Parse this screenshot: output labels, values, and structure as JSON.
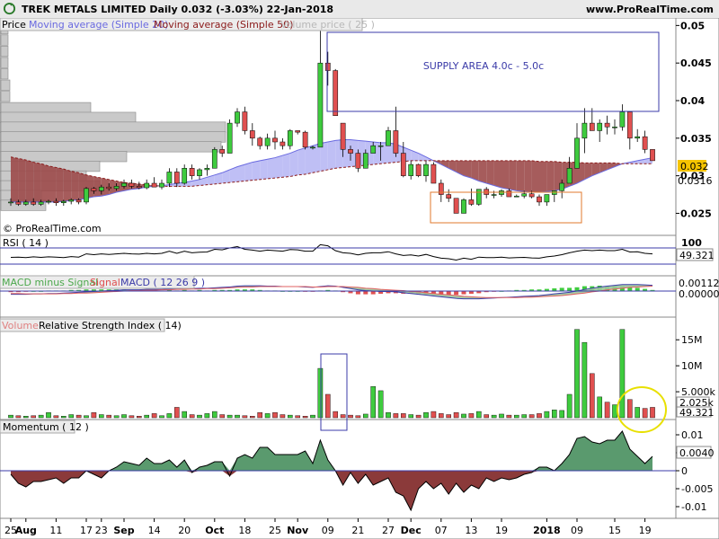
{
  "header": {
    "title": "TREK METALS LIMITED   Daily   0.032 (-3.03%)   22-Jan-2018",
    "site": "www.ProRealTime.com"
  },
  "panels": {
    "price": {
      "legend": [
        "Price",
        "Moving average (Simple 20)",
        "Moving average (Simple 50)",
        "Volume price ( 25 )"
      ],
      "watermark": "© ProRealTime.com",
      "last_label": "0.032",
      "ma_label": "0.0316"
    },
    "rsi": {
      "legend": "RSI ( 14 )",
      "top_label": "100",
      "last_label": "49.321"
    },
    "macd": {
      "legend": [
        "MACD minus Signal",
        "Signal",
        "MACD ( 12 26 9 )"
      ],
      "label1": "0.00112",
      "label2": "0.00000"
    },
    "volume": {
      "legend": [
        "Volume",
        "Relative Strength Index ( 14)"
      ],
      "label1": "2.025k",
      "label2": "49.321"
    },
    "momentum": {
      "legend": "Momentum ( 12 )",
      "last_label": "0.0040"
    }
  },
  "annotations": {
    "supply": "SUPPLY AREA 4.0c - 5.0c"
  },
  "colors": {
    "up": "#3ecb3e",
    "down": "#e05050",
    "ma_fill_bull": "#b8b8f4",
    "ma_fill_bear": "#9c4a4a",
    "supply_box": "#3b3ba8",
    "demand_box": "#e07a2e",
    "highlight_circle": "#e8e000",
    "volume_box": "#3b3ba8"
  },
  "chart_data": {
    "type": "candlestick",
    "x_ticks": [
      {
        "i": 0,
        "label": "25"
      },
      {
        "i": 2,
        "label": "Aug"
      },
      {
        "i": 6,
        "label": "11"
      },
      {
        "i": 10,
        "label": "17"
      },
      {
        "i": 12,
        "label": "23"
      },
      {
        "i": 15,
        "label": "Sep"
      },
      {
        "i": 19,
        "label": "14"
      },
      {
        "i": 23,
        "label": "20"
      },
      {
        "i": 27,
        "label": "Oct"
      },
      {
        "i": 31,
        "label": "18"
      },
      {
        "i": 35,
        "label": "25"
      },
      {
        "i": 38,
        "label": "Nov"
      },
      {
        "i": 42,
        "label": "09"
      },
      {
        "i": 46,
        "label": "21"
      },
      {
        "i": 50,
        "label": "27"
      },
      {
        "i": 53,
        "label": "Dec"
      },
      {
        "i": 57,
        "label": "07"
      },
      {
        "i": 61,
        "label": "13"
      },
      {
        "i": 65,
        "label": "19"
      },
      {
        "i": 71,
        "label": "2018"
      },
      {
        "i": 75,
        "label": "09"
      },
      {
        "i": 80,
        "label": "15"
      },
      {
        "i": 84,
        "label": "19"
      }
    ],
    "price_axis": {
      "ticks": [
        0.025,
        0.03,
        0.035,
        0.04,
        0.045,
        0.05
      ],
      "range": [
        0.0235,
        0.051
      ]
    },
    "candles": [
      [
        0.0265,
        0.027,
        0.026,
        0.0265
      ],
      [
        0.0265,
        0.0268,
        0.026,
        0.0262
      ],
      [
        0.0262,
        0.0268,
        0.026,
        0.0265
      ],
      [
        0.0265,
        0.027,
        0.026,
        0.0262
      ],
      [
        0.0262,
        0.0268,
        0.026,
        0.0265
      ],
      [
        0.0265,
        0.0268,
        0.0262,
        0.0266
      ],
      [
        0.0266,
        0.027,
        0.026,
        0.0264
      ],
      [
        0.0264,
        0.0268,
        0.026,
        0.0266
      ],
      [
        0.0266,
        0.027,
        0.0262,
        0.0268
      ],
      [
        0.0268,
        0.027,
        0.0262,
        0.0265
      ],
      [
        0.0265,
        0.0285,
        0.0262,
        0.0283
      ],
      [
        0.0283,
        0.0285,
        0.0276,
        0.028
      ],
      [
        0.028,
        0.0288,
        0.0275,
        0.0285
      ],
      [
        0.0285,
        0.029,
        0.028,
        0.0283
      ],
      [
        0.0283,
        0.029,
        0.028,
        0.0286
      ],
      [
        0.0286,
        0.0295,
        0.0283,
        0.029
      ],
      [
        0.029,
        0.0295,
        0.0283,
        0.0286
      ],
      [
        0.0286,
        0.0292,
        0.0282,
        0.0284
      ],
      [
        0.0284,
        0.0295,
        0.0282,
        0.029
      ],
      [
        0.029,
        0.0298,
        0.0285,
        0.0285
      ],
      [
        0.0285,
        0.0295,
        0.0282,
        0.029
      ],
      [
        0.029,
        0.031,
        0.0285,
        0.0305
      ],
      [
        0.0305,
        0.031,
        0.0285,
        0.029
      ],
      [
        0.029,
        0.0315,
        0.0288,
        0.031
      ],
      [
        0.031,
        0.0315,
        0.0295,
        0.03
      ],
      [
        0.03,
        0.031,
        0.0295,
        0.0308
      ],
      [
        0.0308,
        0.0315,
        0.03,
        0.031
      ],
      [
        0.031,
        0.0338,
        0.031,
        0.0335
      ],
      [
        0.0335,
        0.034,
        0.0325,
        0.033
      ],
      [
        0.033,
        0.0375,
        0.033,
        0.037
      ],
      [
        0.037,
        0.039,
        0.0365,
        0.0385
      ],
      [
        0.0385,
        0.0392,
        0.0355,
        0.036
      ],
      [
        0.036,
        0.037,
        0.034,
        0.035
      ],
      [
        0.035,
        0.0352,
        0.0335,
        0.034
      ],
      [
        0.034,
        0.0356,
        0.0335,
        0.035
      ],
      [
        0.035,
        0.036,
        0.0335,
        0.0345
      ],
      [
        0.0345,
        0.035,
        0.0335,
        0.034
      ],
      [
        0.034,
        0.0362,
        0.0335,
        0.036
      ],
      [
        0.036,
        0.036,
        0.0355,
        0.0358
      ],
      [
        0.0358,
        0.036,
        0.0335,
        0.0338
      ],
      [
        0.0338,
        0.034,
        0.0335,
        0.0338
      ],
      [
        0.0338,
        0.05,
        0.0338,
        0.045
      ],
      [
        0.045,
        0.0465,
        0.042,
        0.044
      ],
      [
        0.044,
        0.0442,
        0.038,
        0.038
      ],
      [
        0.037,
        0.037,
        0.0325,
        0.0335
      ],
      [
        0.0335,
        0.034,
        0.032,
        0.033
      ],
      [
        0.033,
        0.0335,
        0.0305,
        0.031
      ],
      [
        0.031,
        0.0335,
        0.031,
        0.033
      ],
      [
        0.033,
        0.0345,
        0.033,
        0.034
      ],
      [
        0.034,
        0.0345,
        0.032,
        0.034
      ],
      [
        0.034,
        0.0365,
        0.034,
        0.036
      ],
      [
        0.036,
        0.0392,
        0.0325,
        0.033
      ],
      [
        0.033,
        0.0345,
        0.0298,
        0.03
      ],
      [
        0.03,
        0.032,
        0.0295,
        0.0315
      ],
      [
        0.0315,
        0.0316,
        0.0298,
        0.03
      ],
      [
        0.03,
        0.032,
        0.0292,
        0.0315
      ],
      [
        0.0315,
        0.0318,
        0.029,
        0.029
      ],
      [
        0.029,
        0.0295,
        0.0265,
        0.0275
      ],
      [
        0.0275,
        0.0282,
        0.0265,
        0.027
      ],
      [
        0.027,
        0.027,
        0.025,
        0.025
      ],
      [
        0.025,
        0.027,
        0.025,
        0.0268
      ],
      [
        0.0268,
        0.0283,
        0.026,
        0.0262
      ],
      [
        0.0262,
        0.0282,
        0.026,
        0.0282
      ],
      [
        0.0282,
        0.0285,
        0.027,
        0.0275
      ],
      [
        0.0275,
        0.028,
        0.027,
        0.0275
      ],
      [
        0.0275,
        0.0282,
        0.0272,
        0.028
      ],
      [
        0.028,
        0.0283,
        0.0272,
        0.0272
      ],
      [
        0.0272,
        0.0275,
        0.0272,
        0.0273
      ],
      [
        0.0273,
        0.028,
        0.027,
        0.0276
      ],
      [
        0.0276,
        0.028,
        0.027,
        0.0272
      ],
      [
        0.0272,
        0.0275,
        0.026,
        0.0265
      ],
      [
        0.0265,
        0.0275,
        0.026,
        0.0275
      ],
      [
        0.0275,
        0.028,
        0.0265,
        0.028
      ],
      [
        0.028,
        0.0295,
        0.027,
        0.029
      ],
      [
        0.029,
        0.0325,
        0.029,
        0.031
      ],
      [
        0.031,
        0.037,
        0.031,
        0.035
      ],
      [
        0.035,
        0.039,
        0.033,
        0.037
      ],
      [
        0.037,
        0.039,
        0.036,
        0.036
      ],
      [
        0.036,
        0.0375,
        0.0345,
        0.037
      ],
      [
        0.037,
        0.038,
        0.0355,
        0.0365
      ],
      [
        0.0365,
        0.0375,
        0.0355,
        0.0365
      ],
      [
        0.0365,
        0.0395,
        0.036,
        0.0385
      ],
      [
        0.0385,
        0.0385,
        0.0335,
        0.035
      ],
      [
        0.035,
        0.0362,
        0.0345,
        0.0352
      ],
      [
        0.0352,
        0.036,
        0.033,
        0.0335
      ],
      [
        0.0335,
        0.0335,
        0.032,
        0.032
      ]
    ],
    "ma20": [
      0.0265,
      0.0265,
      0.0265,
      0.0265,
      0.0265,
      0.0265,
      0.0265,
      0.0266,
      0.0267,
      0.0268,
      0.027,
      0.0272,
      0.0273,
      0.0275,
      0.0278,
      0.028,
      0.0282,
      0.0283,
      0.0285,
      0.0286,
      0.0287,
      0.0288,
      0.029,
      0.0291,
      0.0293,
      0.0295,
      0.0298,
      0.0301,
      0.0304,
      0.0308,
      0.0312,
      0.0315,
      0.0318,
      0.032,
      0.0322,
      0.0324,
      0.0327,
      0.033,
      0.0334,
      0.0337,
      0.034,
      0.0343,
      0.0345,
      0.0347,
      0.0348,
      0.0348,
      0.0347,
      0.0346,
      0.0345,
      0.0344,
      0.0344,
      0.0342,
      0.0338,
      0.0334,
      0.033,
      0.0325,
      0.032,
      0.0315,
      0.031,
      0.0305,
      0.03,
      0.0297,
      0.0293,
      0.029,
      0.0287,
      0.0284,
      0.0282,
      0.028,
      0.0279,
      0.0278,
      0.0278,
      0.0279,
      0.028,
      0.0282,
      0.0286,
      0.029,
      0.0295,
      0.03,
      0.0304,
      0.0308,
      0.0312,
      0.0316,
      0.0318,
      0.032,
      0.0322,
      0.0324
    ],
    "ma50": [
      0.0325,
      0.0323,
      0.0321,
      0.0318,
      0.0316,
      0.0313,
      0.0311,
      0.0309,
      0.0306,
      0.0304,
      0.0301,
      0.0299,
      0.0297,
      0.0295,
      0.0293,
      0.0291,
      0.029,
      0.0289,
      0.0288,
      0.0287,
      0.0286,
      0.0286,
      0.0286,
      0.0286,
      0.0286,
      0.0287,
      0.0288,
      0.0289,
      0.029,
      0.0291,
      0.0292,
      0.0293,
      0.0294,
      0.0295,
      0.0296,
      0.0297,
      0.0298,
      0.0299,
      0.0301,
      0.0302,
      0.0304,
      0.0306,
      0.0308,
      0.031,
      0.0311,
      0.0312,
      0.0313,
      0.0314,
      0.0315,
      0.0316,
      0.0317,
      0.0318,
      0.0319,
      0.032,
      0.032,
      0.032,
      0.032,
      0.032,
      0.032,
      0.032,
      0.032,
      0.032,
      0.032,
      0.032,
      0.032,
      0.032,
      0.032,
      0.032,
      0.032,
      0.032,
      0.0319,
      0.0319,
      0.0319,
      0.0318,
      0.0318,
      0.0318,
      0.0317,
      0.0317,
      0.0317,
      0.0317,
      0.0317,
      0.0316,
      0.0316,
      0.0316,
      0.0316,
      0.0316
    ],
    "vp_bins": [
      {
        "price": 0.0495,
        "w": 8
      },
      {
        "price": 0.048,
        "w": 8
      },
      {
        "price": 0.0465,
        "w": 8
      },
      {
        "price": 0.045,
        "w": 8
      },
      {
        "price": 0.0435,
        "w": 8
      },
      {
        "price": 0.042,
        "w": 10
      },
      {
        "price": 0.0405,
        "w": 10
      },
      {
        "price": 0.039,
        "w": 100
      },
      {
        "price": 0.0377,
        "w": 150
      },
      {
        "price": 0.0364,
        "w": 250
      },
      {
        "price": 0.0351,
        "w": 250
      },
      {
        "price": 0.0338,
        "w": 245
      },
      {
        "price": 0.0325,
        "w": 140
      },
      {
        "price": 0.0312,
        "w": 110
      },
      {
        "price": 0.0299,
        "w": 95
      },
      {
        "price": 0.0286,
        "w": 110
      },
      {
        "price": 0.0273,
        "w": 45
      },
      {
        "price": 0.026,
        "w": 50
      }
    ],
    "volume": {
      "axis_ticks": [
        "5.000k",
        "10M",
        "15M"
      ],
      "tick_values": [
        5,
        10,
        15
      ],
      "range": [
        0,
        18.5
      ],
      "values": [
        0.5,
        0.4,
        0.3,
        0.4,
        0.5,
        1,
        0.4,
        0.3,
        0.6,
        0.5,
        0.4,
        1,
        0.6,
        0.5,
        0.4,
        0.6,
        0.4,
        0.3,
        0.5,
        0.8,
        0.4,
        0.8,
        2,
        1.2,
        0.6,
        0.5,
        0.8,
        1.2,
        0.6,
        0.5,
        0.5,
        0.4,
        0.3,
        1,
        0.8,
        1,
        0.6,
        0.5,
        0.4,
        0.3,
        0.5,
        9.5,
        4.5,
        1.2,
        0.6,
        0.5,
        0.4,
        0.7,
        6,
        5.2,
        1,
        0.8,
        0.8,
        0.6,
        0.5,
        1,
        1.2,
        0.8,
        0.6,
        1,
        0.7,
        0.8,
        1.2,
        0.6,
        0.5,
        0.7,
        0.5,
        0.5,
        0.6,
        0.6,
        0.8,
        1.2,
        1.5,
        1.4,
        4.5,
        17,
        14.5,
        8.5,
        4,
        3,
        2.5,
        17,
        3.5,
        2,
        1.8,
        2
      ]
    },
    "rsi": {
      "range": [
        0,
        100
      ],
      "values": [
        45,
        46,
        44,
        47,
        45,
        47,
        46,
        44,
        48,
        46,
        58,
        55,
        58,
        56,
        58,
        60,
        58,
        57,
        60,
        58,
        60,
        68,
        60,
        68,
        62,
        64,
        65,
        75,
        73,
        80,
        85,
        75,
        72,
        68,
        72,
        70,
        68,
        74,
        73,
        68,
        68,
        92,
        88,
        70,
        62,
        60,
        54,
        60,
        62,
        62,
        66,
        58,
        52,
        54,
        50,
        56,
        48,
        42,
        40,
        35,
        42,
        38,
        46,
        44,
        44,
        46,
        43,
        44,
        45,
        43,
        42,
        47,
        50,
        55,
        62,
        68,
        72,
        70,
        72,
        70,
        70,
        75,
        65,
        66,
        60,
        58
      ]
    },
    "macd": {
      "range": [
        -0.003,
        0.0025
      ],
      "macd": [
        -0.0005,
        -0.0005,
        -0.0005,
        -0.0004,
        -0.0004,
        -0.0003,
        -0.0003,
        -0.0002,
        -0.0001,
        0,
        0.0001,
        0.0002,
        0.0003,
        0.0004,
        0.0005,
        0.0006,
        0.0006,
        0.0006,
        0.0007,
        0.0007,
        0.0007,
        0.0008,
        0.0008,
        0.0009,
        0.0009,
        0.001,
        0.001,
        0.0011,
        0.0012,
        0.0013,
        0.0015,
        0.0016,
        0.0016,
        0.0016,
        0.0015,
        0.0015,
        0.0014,
        0.0014,
        0.0014,
        0.0013,
        0.0012,
        0.0014,
        0.0016,
        0.0015,
        0.0012,
        0.0009,
        0.0006,
        0.0004,
        0.0003,
        0.0002,
        0.0002,
        0.0001,
        -0.0001,
        -0.0003,
        -0.0005,
        -0.0007,
        -0.0009,
        -0.0011,
        -0.0013,
        -0.0015,
        -0.0016,
        -0.0016,
        -0.0016,
        -0.0015,
        -0.0014,
        -0.0013,
        -0.0012,
        -0.0011,
        -0.001,
        -0.0009,
        -0.0008,
        -0.0006,
        -0.0004,
        -0.0002,
        0,
        0.0003,
        0.0007,
        0.001,
        0.0013,
        0.0015,
        0.0017,
        0.0019,
        0.0019,
        0.0019,
        0.0018,
        0.0017
      ],
      "signal": [
        -0.0003,
        -0.0003,
        -0.0004,
        -0.0004,
        -0.0004,
        -0.0004,
        -0.0004,
        -0.0003,
        -0.0003,
        -0.0002,
        -0.0002,
        -0.0001,
        0,
        0.0001,
        0.0002,
        0.0003,
        0.0004,
        0.0004,
        0.0005,
        0.0005,
        0.0006,
        0.0006,
        0.0007,
        0.0007,
        0.0008,
        0.0008,
        0.0009,
        0.0009,
        0.001,
        0.0011,
        0.0012,
        0.0013,
        0.0013,
        0.0014,
        0.0014,
        0.0014,
        0.0014,
        0.0014,
        0.0014,
        0.0014,
        0.0013,
        0.0013,
        0.0014,
        0.0014,
        0.0014,
        0.0013,
        0.0012,
        0.001,
        0.0009,
        0.0007,
        0.0006,
        0.0005,
        0.0004,
        0.0002,
        0.0001,
        -0.0001,
        -0.0003,
        -0.0005,
        -0.0006,
        -0.0008,
        -0.001,
        -0.0011,
        -0.0012,
        -0.0013,
        -0.0013,
        -0.0013,
        -0.0013,
        -0.0013,
        -0.0012,
        -0.0012,
        -0.0011,
        -0.001,
        -0.0009,
        -0.0008,
        -0.0006,
        -0.0004,
        -0.0002,
        0.0001,
        0.0003,
        0.0006,
        0.0008,
        0.001,
        0.0012,
        0.0013,
        0.0014,
        0.0015
      ]
    },
    "momentum": {
      "range": [
        -0.0125,
        0.0125
      ],
      "axis_ticks": [
        0.01,
        0.005,
        0,
        -0.005,
        -0.01
      ],
      "values": [
        -0.001,
        -0.0035,
        -0.0045,
        -0.003,
        -0.003,
        -0.0025,
        -0.002,
        -0.0035,
        -0.002,
        -0.002,
        0,
        -0.001,
        -0.002,
        0,
        0.001,
        0.0025,
        0.002,
        0.0015,
        0.0035,
        0.002,
        0.002,
        0.003,
        0.001,
        0.003,
        -0.0005,
        0.001,
        0.0015,
        0.0025,
        0.0025,
        -0.0015,
        0.0035,
        0.0045,
        0.0035,
        0.0065,
        0.0065,
        0.0045,
        0.0045,
        0.0045,
        0.0045,
        0.0055,
        0.002,
        0.0085,
        0.003,
        0,
        -0.004,
        -0.0005,
        -0.0035,
        -0.001,
        -0.004,
        -0.003,
        -0.002,
        -0.006,
        -0.007,
        -0.011,
        -0.005,
        -0.003,
        -0.005,
        -0.0035,
        -0.0065,
        -0.0035,
        -0.006,
        -0.004,
        -0.005,
        -0.002,
        -0.003,
        -0.002,
        -0.0025,
        -0.002,
        -0.001,
        -0.0005,
        0.001,
        0.001,
        0,
        0.002,
        0.0045,
        0.009,
        0.0095,
        0.008,
        0.0075,
        0.0085,
        0.0085,
        0.011,
        0.006,
        0.004,
        0.002,
        0.004
      ]
    }
  }
}
